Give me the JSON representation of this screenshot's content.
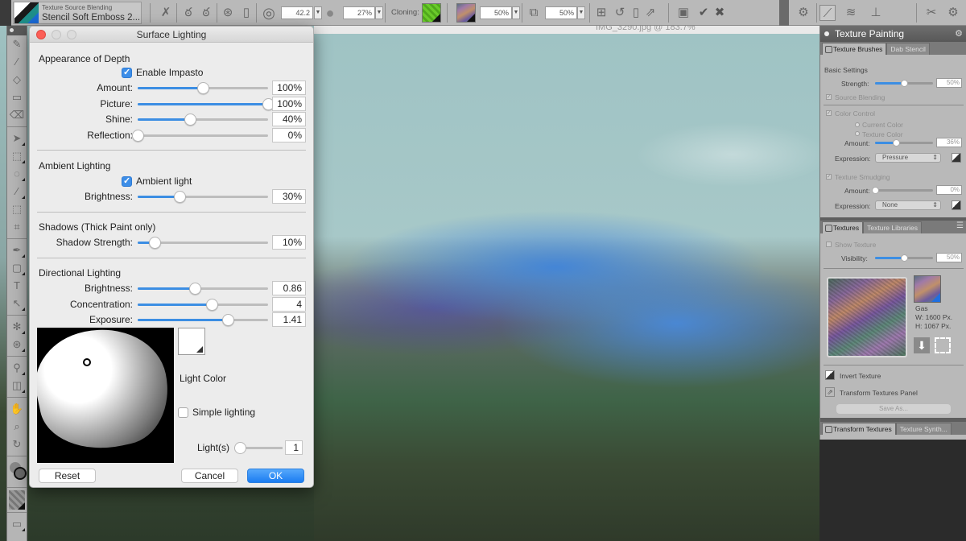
{
  "property_bar": {
    "variant_category": "Texture Source Blending",
    "variant_name": "Stencil Soft Emboss 2...",
    "size_value": "42.2",
    "opacity_value": "27%",
    "cloning_label": "Cloning:",
    "texture_opacity": "50%",
    "layer_opacity": "50%",
    "icons": [
      "brush-tracking-icon",
      "stroke-icon",
      "stroke-alt-icon",
      "dab-icon",
      "clone-icon",
      "size-icon",
      "opacity-icon",
      "clone-color-swatch",
      "texture-swatch",
      "source-image-icon",
      "transform-icon",
      "reset-icon",
      "mirror-icon",
      "export-icon",
      "save-icon",
      "commit-icon",
      "cancel-icon",
      "layout-icon",
      "texture-painting-icon",
      "texture-brush-icon",
      "stamp-icon",
      "brush-settings-icon",
      "preferences-icon"
    ]
  },
  "document": {
    "title": "IMG_3290.jpg @ 183.7%"
  },
  "toolbox": {
    "tools": [
      {
        "name": "brush-tool",
        "glyph": "✎",
        "sub": false
      },
      {
        "name": "dropper-tool",
        "glyph": "⁄",
        "sub": false
      },
      {
        "name": "paint-bucket-tool",
        "glyph": "◇",
        "sub": false
      },
      {
        "name": "gradient-tool",
        "glyph": "▭",
        "sub": false
      },
      {
        "name": "eraser-tool",
        "glyph": "⌫",
        "sub": false
      },
      {
        "name": "sep"
      },
      {
        "name": "layer-adjuster-tool",
        "glyph": "➤",
        "sub": true
      },
      {
        "name": "rect-select-tool",
        "glyph": "⬚",
        "sub": true
      },
      {
        "name": "lasso-tool",
        "glyph": "◌",
        "sub": true
      },
      {
        "name": "magic-wand-tool",
        "glyph": "⁄",
        "sub": true
      },
      {
        "name": "selection-adjuster-tool",
        "glyph": "⬚",
        "sub": false
      },
      {
        "name": "crop-tool",
        "glyph": "⌗",
        "sub": false
      },
      {
        "name": "sep"
      },
      {
        "name": "pen-tool",
        "glyph": "✒",
        "sub": true
      },
      {
        "name": "shape-tool",
        "glyph": "▢",
        "sub": true
      },
      {
        "name": "text-tool",
        "glyph": "T",
        "sub": false
      },
      {
        "name": "shape-selection-tool",
        "glyph": "↖",
        "sub": true
      },
      {
        "name": "sep"
      },
      {
        "name": "cloner-tool",
        "glyph": "✻",
        "sub": true
      },
      {
        "name": "rubber-stamp-tool",
        "glyph": "⊛",
        "sub": true
      },
      {
        "name": "sep"
      },
      {
        "name": "mirror-tool",
        "glyph": "⚲",
        "sub": true
      },
      {
        "name": "perspective-guides-tool",
        "glyph": "◫",
        "sub": true
      },
      {
        "name": "sep"
      },
      {
        "name": "grabber-tool",
        "glyph": "✋",
        "sub": false
      },
      {
        "name": "magnifier-tool",
        "glyph": "⌕",
        "sub": false
      },
      {
        "name": "rotate-page-tool",
        "glyph": "↻",
        "sub": false
      }
    ]
  },
  "dialog": {
    "title": "Surface Lighting",
    "appearance": {
      "heading": "Appearance of Depth",
      "enable_impasto_label": "Enable Impasto",
      "enable_impasto": true,
      "sliders": [
        {
          "label": "Amount:",
          "value": "100%",
          "position": 0.5
        },
        {
          "label": "Picture:",
          "value": "100%",
          "position": 1.0
        },
        {
          "label": "Shine:",
          "value": "40%",
          "position": 0.4
        },
        {
          "label": "Reflection:",
          "value": "0%",
          "position": 0.0
        }
      ]
    },
    "ambient": {
      "heading": "Ambient Lighting",
      "ambient_light_label": "Ambient light",
      "ambient_light": true,
      "sliders": [
        {
          "label": "Brightness:",
          "value": "30%",
          "position": 0.32
        }
      ]
    },
    "shadows": {
      "heading": "Shadows (Thick Paint only)",
      "sliders": [
        {
          "label": "Shadow Strength:",
          "value": "10%",
          "position": 0.13
        }
      ]
    },
    "directional": {
      "heading": "Directional Lighting",
      "sliders": [
        {
          "label": "Brightness:",
          "value": "0.86",
          "position": 0.44
        },
        {
          "label": "Concentration:",
          "value": "4",
          "position": 0.57
        },
        {
          "label": "Exposure:",
          "value": "1.41",
          "position": 0.69
        }
      ]
    },
    "light_color_label": "Light Color",
    "light_color": "#ffffff",
    "simple_lighting_label": "Simple lighting",
    "simple_lighting": false,
    "lights_label": "Light(s)",
    "lights_value": "1",
    "reset_label": "Reset",
    "cancel_label": "Cancel",
    "ok_label": "OK"
  },
  "texture_panel": {
    "title": "Texture Painting",
    "tabs": [
      "Texture Brushes",
      "Dab Stencil"
    ],
    "basic_settings_label": "Basic Settings",
    "strength_label": "Strength:",
    "strength_value": "50%",
    "strength_position": 0.5,
    "source_blending_label": "Source Blending",
    "color_control_label": "Color Control",
    "current_color_label": "Current Color",
    "texture_color_label": "Texture Color",
    "color_amount_label": "Amount:",
    "color_amount_value": "36%",
    "color_amount_position": 0.36,
    "color_expression_label": "Expression:",
    "color_expression_value": "Pressure",
    "texture_smudging_label": "Texture Smudging",
    "smudge_amount_label": "Amount:",
    "smudge_amount_value": "0%",
    "smudge_amount_position": 0.0,
    "smudge_expression_label": "Expression:",
    "smudge_expression_value": "None"
  },
  "textures_panel": {
    "tabs": [
      "Textures",
      "Texture Libraries"
    ],
    "show_texture_label": "Show Texture",
    "visibility_label": "Visibility:",
    "visibility_value": "50%",
    "visibility_position": 0.5,
    "texture_name": "Gas",
    "texture_width": "W:  1600 Px.",
    "texture_height": "H:  1067 Px.",
    "invert_texture_label": "Invert Texture",
    "transform_panel_label": "Transform Textures Panel",
    "save_as_label": "Save As..."
  },
  "transform_panel": {
    "tabs": [
      "Transform Textures",
      "Texture Synth..."
    ]
  }
}
